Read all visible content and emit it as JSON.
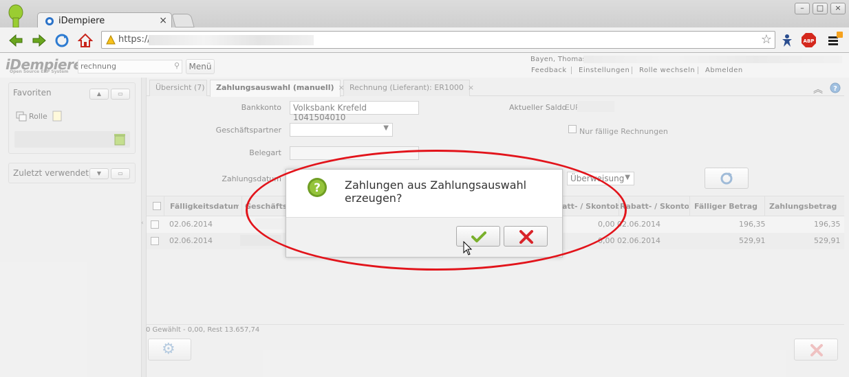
{
  "browser": {
    "tab_title": "iDempiere",
    "tab_close": "×",
    "url_prefix": "https://",
    "window_controls": [
      "–",
      "□",
      "×"
    ]
  },
  "app": {
    "logo": "iDempiere",
    "logo_sub": "Open Source   ERP System",
    "search_value": "rechnung",
    "menu_label": "Menü",
    "user": "Bayen, Thomas@",
    "header_links": [
      "Feedback",
      "Einstellungen",
      "Rolle wechseln",
      "Abmelden"
    ]
  },
  "left_panel": {
    "favorites_title": "Favoriten",
    "favorites_item": "Rolle",
    "recent_title": "Zuletzt verwendet"
  },
  "tabs": [
    {
      "label": "Übersicht (7)"
    },
    {
      "label": "Zahlungsauswahl (manuell)",
      "close": "×"
    },
    {
      "label": "Rechnung (Lieferant): ER1000",
      "close": "×"
    }
  ],
  "form": {
    "bankkonto_label": "Bankkonto",
    "bankkonto_value": "Volksbank Krefeld 1041504010",
    "saldo_label": "Aktueller Saldo",
    "saldo_value": "EUR",
    "partner_label": "Geschäftspartner",
    "faellig_label": "Nur fällige Rechnungen",
    "belegart_label": "Belegart",
    "zahlungsdatum_label": "Zahlungsdatum",
    "zahlungsart_value": "Überweisung"
  },
  "grid": {
    "headers": [
      "Fälligkeitsdatum",
      "Geschäftsp",
      "att- / Skontobe",
      "Rabatt- / Skontodat",
      "Fälliger Betrag",
      "Zahlungsbetrag"
    ],
    "rows": [
      {
        "date": "02.06.2014",
        "skonto": "0,00",
        "skonto_date": "02.06.2014",
        "due": "196,35",
        "pay": "196,35"
      },
      {
        "date": "02.06.2014",
        "skonto": "0,00",
        "skonto_date": "02.06.2014",
        "due": "529,91",
        "pay": "529,91"
      }
    ],
    "footer": "0 Gewählt - 0,00, Rest 13.657,74"
  },
  "dialog": {
    "message": "Zahlungen aus Zahlungsauswahl erzeugen?",
    "ok_icon": "checkmark-icon",
    "cancel_icon": "x-icon"
  },
  "colors": {
    "highlight": "#e2141b",
    "ok_green": "#7ab02c",
    "cancel_red": "#d9242a"
  }
}
